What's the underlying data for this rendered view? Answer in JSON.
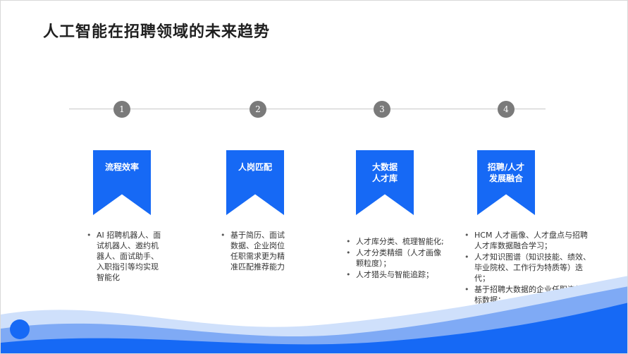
{
  "title": "人工智能在招聘领域的未来趋势",
  "steps": [
    {
      "number": "1",
      "label": "流程效率",
      "bullets": [
        "AI 招聘机器人、面试机器人、邀约机器人、面试助手、入职指引等均实现智能化"
      ]
    },
    {
      "number": "2",
      "label": "人岗匹配",
      "bullets": [
        "基于简历、面试数据、企业岗位任职需求更为精准匹配推荐能力"
      ]
    },
    {
      "number": "3",
      "label": "大数据\n人才库",
      "bullets": [
        "人才库分类、梳理智能化;",
        "人才分类精细（人才画像颗粒度）；",
        "人才猎头与智能追踪；"
      ]
    },
    {
      "number": "4",
      "label": "招聘/人才\n发展融合",
      "bullets": [
        "HCM 人才画像、人才盘点与招聘人才库数据融合学习；",
        "人才知识图谱（知识技能、绩效、毕业院校、工作行为特质等）迭代；",
        "基于招聘大数据的企业任职资格指标数据；"
      ]
    }
  ],
  "colors": {
    "accent": "#1669f5",
    "circle": "#7a7a7a"
  }
}
